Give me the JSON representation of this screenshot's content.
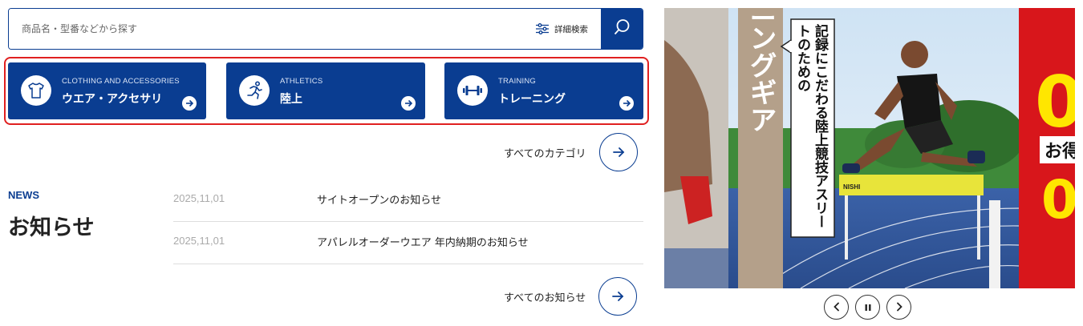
{
  "search": {
    "placeholder": "商品名・型番などから探す",
    "advanced_label": "詳細検索"
  },
  "categories": [
    {
      "sub": "CLOTHING AND ACCESSORIES",
      "label": "ウエア・アクセサリ",
      "icon": "tshirt-icon"
    },
    {
      "sub": "ATHLETICS",
      "label": "陸上",
      "icon": "runner-icon"
    },
    {
      "sub": "TRAINING",
      "label": "トレーニング",
      "icon": "dumbbell-icon"
    }
  ],
  "all_categories_label": "すべてのカテゴリ",
  "news": {
    "label": "NEWS",
    "title": "お知らせ",
    "items": [
      {
        "date": "2025,11,01",
        "title": "サイトオープンのお知らせ"
      },
      {
        "date": "2025,11,01",
        "title": "アパレルオーダーウエア 年内納期のお知らせ"
      }
    ],
    "all_label": "すべてのお知らせ"
  },
  "banner": {
    "vertical_title": "トレーニングギア",
    "callout": "記録にこだわる陸上競技アスリートのための",
    "hurdle_text": "NISHI",
    "next_slide_text": [
      "0",
      "お得",
      "0"
    ]
  },
  "colors": {
    "accent": "#0a3d91",
    "highlight": "#e02020"
  }
}
